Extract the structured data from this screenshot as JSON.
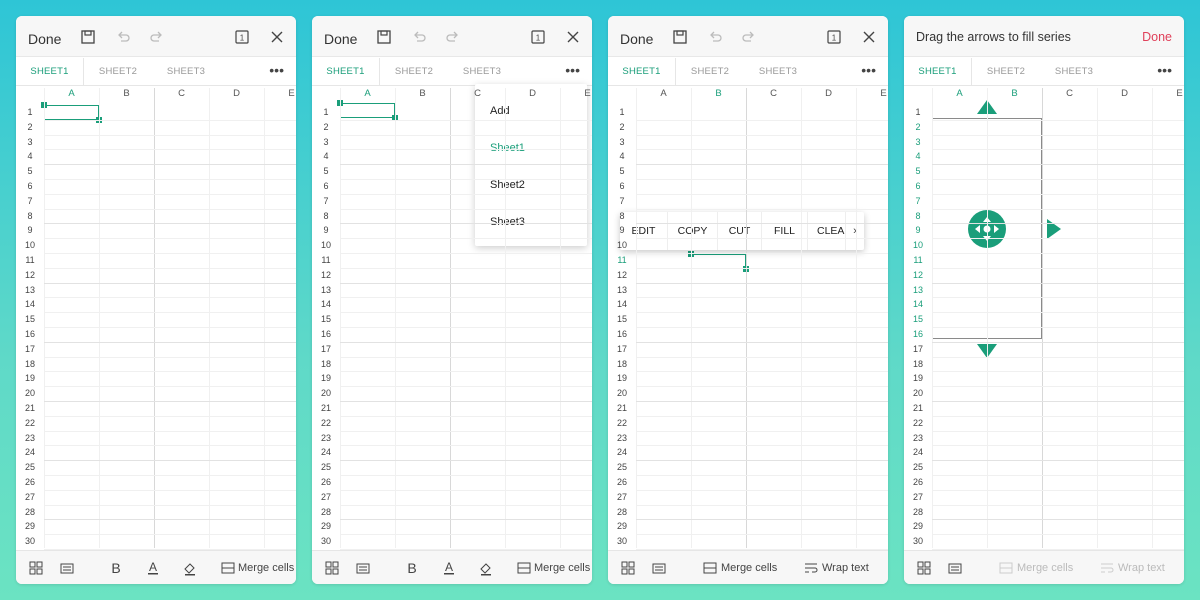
{
  "colors": {
    "accent": "#1a9e7a",
    "done_red": "#e0405a"
  },
  "toolbar": {
    "done_label": "Done",
    "save_icon": "save-icon",
    "undo_icon": "undo-icon",
    "redo_icon": "redo-icon",
    "page_icon": "page-count-icon",
    "page_count": "1",
    "close_icon": "close-icon"
  },
  "tabs": [
    "SHEET1",
    "SHEET2",
    "SHEET3"
  ],
  "more_label": "•••",
  "columns": [
    "A",
    "B",
    "C",
    "D",
    "E"
  ],
  "rows": [
    "1",
    "2",
    "3",
    "4",
    "5",
    "6",
    "7",
    "8",
    "9",
    "10",
    "11",
    "12",
    "13",
    "14",
    "15",
    "16",
    "17",
    "18",
    "19",
    "20",
    "21",
    "22",
    "23",
    "24",
    "25",
    "26",
    "27",
    "28",
    "29",
    "30"
  ],
  "panel1_bottom": {
    "bold_label": "B",
    "text_color_label": "A",
    "merge_label": "Merge cells"
  },
  "panel2_dropdown": {
    "items": [
      "Add",
      "Sheet1",
      "Sheet2",
      "Sheet3"
    ]
  },
  "panel3_context": {
    "items": [
      "EDIT",
      "COPY",
      "CUT",
      "FILL",
      "CLEAR"
    ],
    "more_arrow": "›"
  },
  "panel3_bottom": {
    "merge_label": "Merge cells",
    "wrap_label": "Wrap text"
  },
  "panel4": {
    "hint": "Drag the arrows to fill series",
    "done_label": "Done"
  }
}
